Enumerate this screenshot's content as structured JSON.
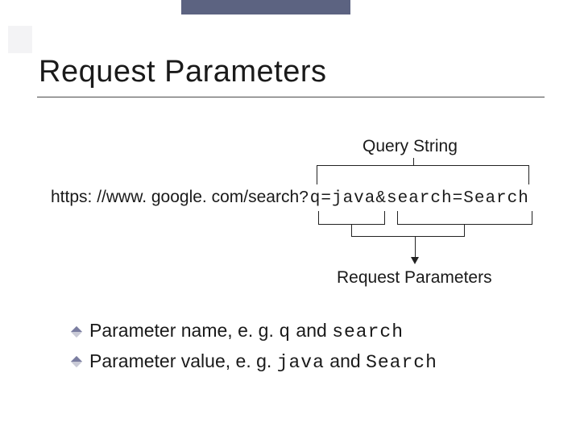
{
  "title": "Request Parameters",
  "labels": {
    "query_string": "Query String",
    "request_params": "Request Parameters"
  },
  "url": {
    "scheme": "https: //www. google. com/search",
    "qmark": "?",
    "p1name": "q",
    "eq1": "=",
    "p1val": "java",
    "amp": "&",
    "p2name": "search",
    "eq2": "=",
    "p2val": "Search"
  },
  "bullets": [
    {
      "prefix": "Parameter name, e. g. ",
      "code1": "q",
      "mid": " and ",
      "code2": "search"
    },
    {
      "prefix": "Parameter value, e. g. ",
      "code1": "java",
      "mid": " and ",
      "code2": "Search"
    }
  ]
}
